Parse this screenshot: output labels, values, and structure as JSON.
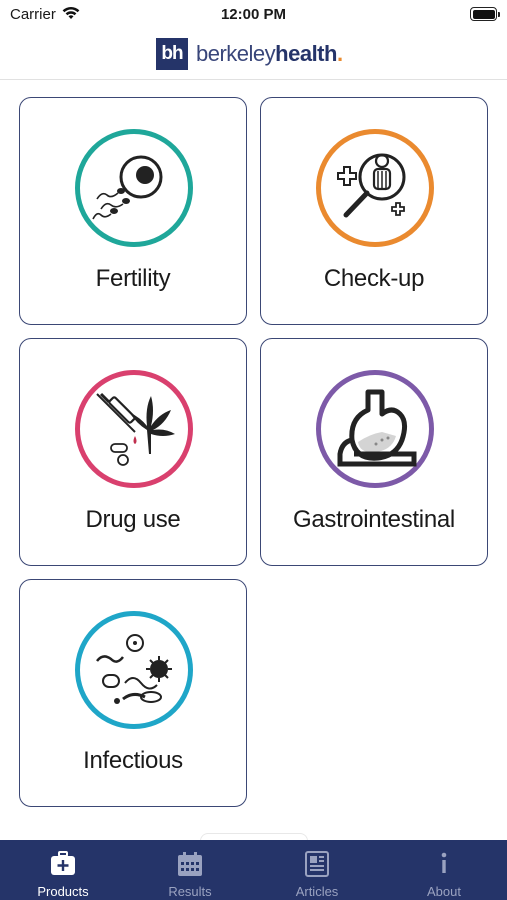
{
  "status_bar": {
    "carrier": "Carrier",
    "time": "12:00 PM"
  },
  "header": {
    "logo_mark": "bh",
    "logo_light": "berkeley",
    "logo_bold": "health"
  },
  "products": [
    {
      "label": "Fertility",
      "icon": "sperm-egg-icon",
      "ring_color": "#1fa79a"
    },
    {
      "label": "Check-up",
      "icon": "magnifier-person-icon",
      "ring_color": "#ea8a2f"
    },
    {
      "label": "Drug use",
      "icon": "syringe-cannabis-icon",
      "ring_color": "#d9406e"
    },
    {
      "label": "Gastrointestinal",
      "icon": "stomach-icon",
      "ring_color": "#7d5aa8"
    },
    {
      "label": "Infectious",
      "icon": "microbes-icon",
      "ring_color": "#1fa6c8"
    }
  ],
  "tabs": [
    {
      "label": "Products",
      "icon": "medical-bag-icon",
      "active": true
    },
    {
      "label": "Results",
      "icon": "calendar-icon",
      "active": false
    },
    {
      "label": "Articles",
      "icon": "newspaper-icon",
      "active": false
    },
    {
      "label": "About",
      "icon": "info-icon",
      "active": false
    }
  ],
  "colors": {
    "brand_navy": "#253469",
    "brand_orange": "#e98a2e",
    "tab_inactive": "#9aa2c0"
  }
}
